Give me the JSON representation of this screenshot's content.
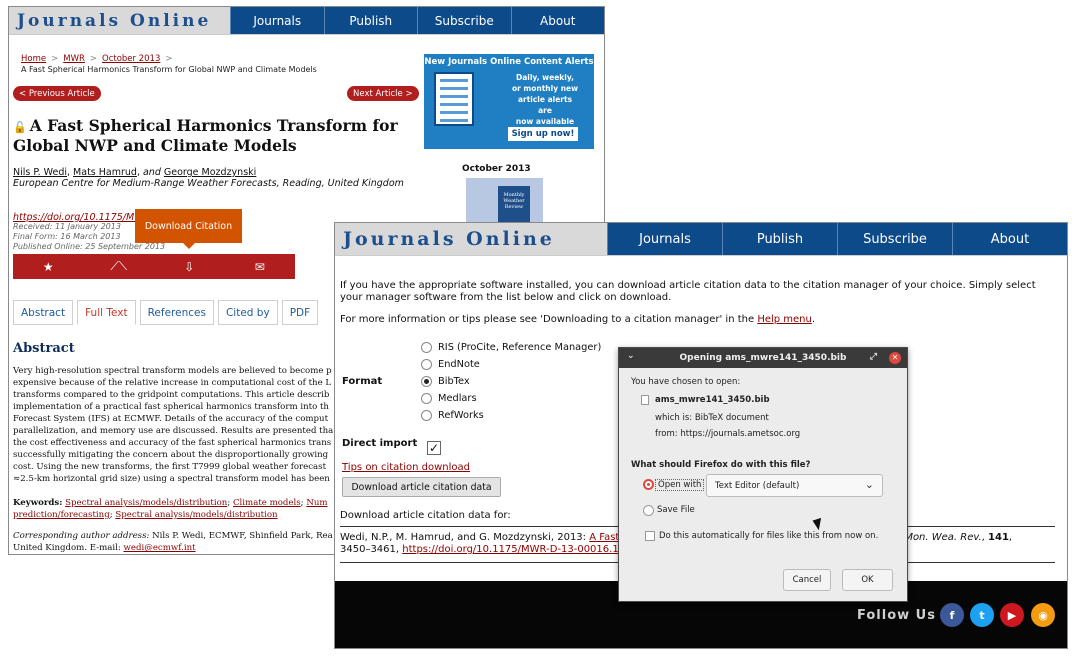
{
  "site": {
    "logo": "Journals Online",
    "nav": [
      "Journals",
      "Publish",
      "Subscribe",
      "About"
    ]
  },
  "article_page": {
    "breadcrumb": [
      "Home",
      "MWR",
      "October 2013"
    ],
    "breadcrumb_current": "A Fast Spherical Harmonics Transform for Global NWP and Climate Models",
    "prev_label": "< Previous Article",
    "next_label": "Next Article >",
    "title": "A Fast Spherical Harmonics Transform for Global NWP and Climate Models",
    "authors": [
      "Nils P. Wedi",
      "Mats Hamrud",
      "and",
      "George Mozdzynski"
    ],
    "affiliation": "European Centre for Medium-Range Weather Forecasts, Reading, United Kingdom",
    "doi": "https://doi.org/10.1175/MW",
    "received": "Received: 11 January 2013",
    "final_form": "Final Form: 16 March 2013",
    "published": "Published Online: 25 September 2013",
    "tooltip": "Download Citation",
    "tabs": [
      "Abstract",
      "Full Text",
      "References",
      "Cited by",
      "PDF"
    ],
    "abstract_heading": "Abstract",
    "abstract_lines": [
      "Very high-resolution spectral transform models are believed to become p",
      "expensive because of the relative increase in computational cost of the L",
      "transforms compared to the gridpoint computations. This article describ",
      "implementation of a practical fast spherical harmonics transform into th",
      "Forecast System (IFS) at ECMWF. Details of the accuracy of the comput",
      "parallelization, and memory use are discussed. Results are presented tha",
      "the cost effectiveness and accuracy of the fast spherical harmonics trans",
      "successfully mitigating the concern about the disproportionally growing",
      "cost. Using the new transforms, the first T7999 global weather forecast",
      "≈2.5-km horizontal grid size) using a spectral transform model has been"
    ],
    "keywords_label": "Keywords:",
    "keywords": [
      "Spectral analysis/models/distribution",
      "Climate models",
      "Num",
      "prediction/forecasting",
      "Spectral analysis/models/distribution"
    ],
    "corr_label": "Corresponding author address:",
    "corr_text": "Nils P. Wedi, ECMWF, Shinfield Park, Rea",
    "corr_text2": "United Kingdom. E-mail:",
    "corr_email": "wedi@ecmwf.int",
    "ad": {
      "title": "New Journals Online Content Alerts",
      "lines": [
        "Daily, weekly,",
        "or monthly new",
        "article alerts",
        "are",
        "now available"
      ],
      "button": "Sign up now!"
    },
    "issue_date": "October 2013",
    "cover_text": "Monthly Weather Review"
  },
  "citation_page": {
    "intro": "If you have the appropriate software installed, you can download article citation data to the citation manager of your choice. Simply select your manager software from the list below and click on download.",
    "more_prefix": "For more information or tips please see 'Downloading to a citation manager' in the ",
    "more_link": "Help menu",
    "more_suffix": ".",
    "format_label": "Format",
    "formats": [
      "RIS (ProCite, Reference Manager)",
      "EndNote",
      "BibTex",
      "Medlars",
      "RefWorks"
    ],
    "selected_format": "BibTex",
    "direct_import_label": "Direct import",
    "direct_import_checked": true,
    "tips_link": "Tips on citation download",
    "download_button": "Download article citation data",
    "download_for": "Download article citation data for:",
    "citation_prefix": "Wedi, N.P., M. Hamrud, and G. Mozdzynski, 2013: ",
    "citation_link": "A Fast Sph",
    "citation_tail_link": "s.",
    "citation_journal": "Mon. Wea. Rev.",
    "citation_volume": "141",
    "citation_pages": "3450–3461, ",
    "citation_doi": "https://doi.org/10.1175/MWR-D-13-00016.1",
    "follow_us": "Follow Us",
    "social": [
      {
        "name": "facebook-icon",
        "glyph": "f",
        "color": "#3b5998"
      },
      {
        "name": "twitter-icon",
        "glyph": "t",
        "color": "#1da1f2"
      },
      {
        "name": "youtube-icon",
        "glyph": "▶",
        "color": "#cc181e"
      },
      {
        "name": "rss-icon",
        "glyph": "◉",
        "color": "#f39c12"
      }
    ]
  },
  "dialog": {
    "title": "Opening ams_mwre141_3450.bib",
    "chosen": "You have chosen to open:",
    "filename": "ams_mwre141_3450.bib",
    "which_is": "which is:  BibTeX document",
    "from": "from:  https://journals.ametsoc.org",
    "question": "What should Firefox do with this file?",
    "open_with": "Open with",
    "app": "Text Editor (default)",
    "save_file": "Save File",
    "auto": "Do this automatically for files like this from now on.",
    "cancel": "Cancel",
    "ok": "OK"
  },
  "colors": {
    "nav_blue": "#0d4a8a",
    "accent_red": "#b01e1e",
    "link_red": "#8b0000",
    "tooltip_orange": "#d35400"
  }
}
